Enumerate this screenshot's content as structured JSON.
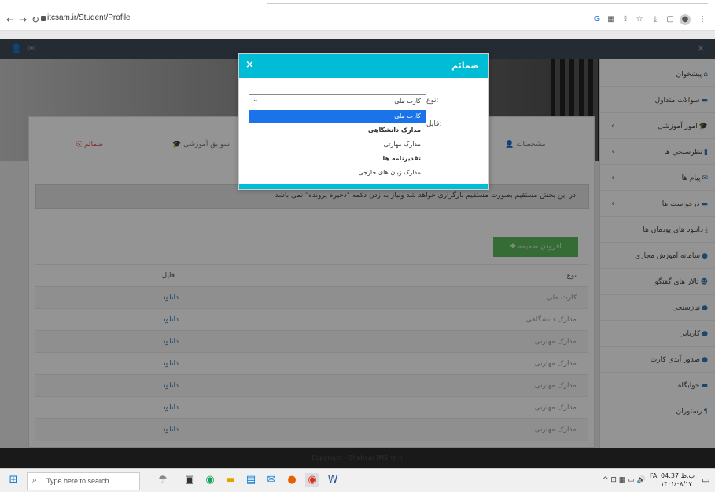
{
  "browser": {
    "url": "itcsam.ir/Student/Profile"
  },
  "tabs": {
    "files": "ضمائم",
    "records": "سوابق آموزشی",
    "profile": "مشخصات"
  },
  "alert_text": "در این بخش مستقیم بصورت مستقیم بارگزاری خواهد شد ونیاز به زدن دکمه \"ذخیره پرونده\" نمی باشد",
  "add_button": "افزودن ضمیمه",
  "table": {
    "headers": [
      "نوع",
      "فایل"
    ],
    "rows": [
      [
        "کارت ملی",
        "دانلود"
      ],
      [
        "مدارک دانشگاهی",
        "دانلود"
      ],
      [
        "مدارک مهارتی",
        "دانلود"
      ],
      [
        "مدارک مهارتی",
        "دانلود"
      ],
      [
        "مدارک مهارتی",
        "دانلود"
      ],
      [
        "مدارک مهارتی",
        "دانلود"
      ],
      [
        "مدارک مهارتی",
        "دانلود"
      ]
    ]
  },
  "footer": "Copyright - Shahvar IMS ۱۴۰۱",
  "sidebar": [
    {
      "label": "پیشخوان",
      "icon": "home-icon",
      "chevron": false
    },
    {
      "label": "سوالات متداول",
      "icon": "chat-icon",
      "chevron": false
    },
    {
      "label": "امور آموزشی",
      "icon": "graduation-icon",
      "chevron": true
    },
    {
      "label": "نظرسنجی ها",
      "icon": "chart-icon",
      "chevron": true
    },
    {
      "label": "پیام ها",
      "icon": "mail-icon",
      "chevron": true
    },
    {
      "label": "درخواست ها",
      "icon": "comment-icon",
      "chevron": true
    },
    {
      "label": "دانلود های پودمان ها",
      "icon": "download-icon",
      "chevron": false
    },
    {
      "label": "سامانه آموزش مجازی",
      "icon": "play-icon",
      "chevron": false
    },
    {
      "label": "تالار های گفتگو",
      "icon": "users-icon",
      "chevron": false
    },
    {
      "label": "نیازسنجی",
      "icon": "help-icon",
      "chevron": false
    },
    {
      "label": "کاریابی",
      "icon": "help-icon",
      "chevron": false
    },
    {
      "label": "صدور آیدی کارت",
      "icon": "help-icon",
      "chevron": false
    },
    {
      "label": "خوابگاه",
      "icon": "bed-icon",
      "chevron": false
    },
    {
      "label": "رستوران",
      "icon": "cutlery-icon",
      "chevron": false
    }
  ],
  "modal": {
    "title": "ضمائم",
    "close": "×",
    "type_label": "نوع:",
    "file_label": "فایل:",
    "selected": "کارت ملی",
    "options": [
      "کارت ملی",
      "مدارک دانشگاهی",
      "مدارک مهارتی",
      "تقدیرنامه ها",
      "مدارک زبان های خارجی"
    ]
  },
  "taskbar": {
    "search_placeholder": "Type here to search",
    "time": "04:37 ب.ظ",
    "date": "۱۴۰۱/۰۸/۱۷",
    "lang": "FA"
  }
}
